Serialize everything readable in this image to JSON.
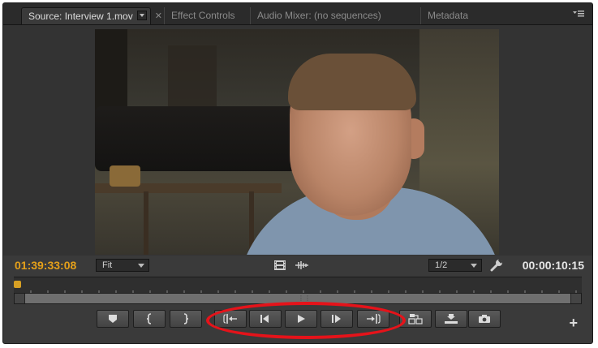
{
  "tabs": [
    {
      "label": "Source: Interview 1.mov",
      "active": true
    },
    {
      "label": "Effect Controls",
      "active": false
    },
    {
      "label": "Audio Mixer: (no sequences)",
      "active": false
    },
    {
      "label": "Metadata",
      "active": false
    }
  ],
  "timecode_current": "01:39:33:08",
  "timecode_duration": "00:00:10:15",
  "zoom_select": {
    "value": "Fit"
  },
  "resolution_select": {
    "value": "1/2"
  },
  "accent_color": "#e4a01a",
  "highlight_color": "#e5131a",
  "transport_buttons": [
    {
      "name": "add-marker-button",
      "icon": "marker-icon"
    },
    {
      "name": "mark-in-button",
      "icon": "mark-in-icon"
    },
    {
      "name": "mark-out-button",
      "icon": "mark-out-icon"
    },
    {
      "name": "go-to-in-button",
      "icon": "go-to-in-icon"
    },
    {
      "name": "step-back-button",
      "icon": "step-back-icon"
    },
    {
      "name": "play-button",
      "icon": "play-icon"
    },
    {
      "name": "step-forward-button",
      "icon": "step-forward-icon"
    },
    {
      "name": "go-to-out-button",
      "icon": "go-to-out-icon"
    },
    {
      "name": "insert-button",
      "icon": "insert-icon"
    },
    {
      "name": "overwrite-button",
      "icon": "overwrite-icon"
    },
    {
      "name": "export-frame-button",
      "icon": "camera-icon"
    }
  ]
}
